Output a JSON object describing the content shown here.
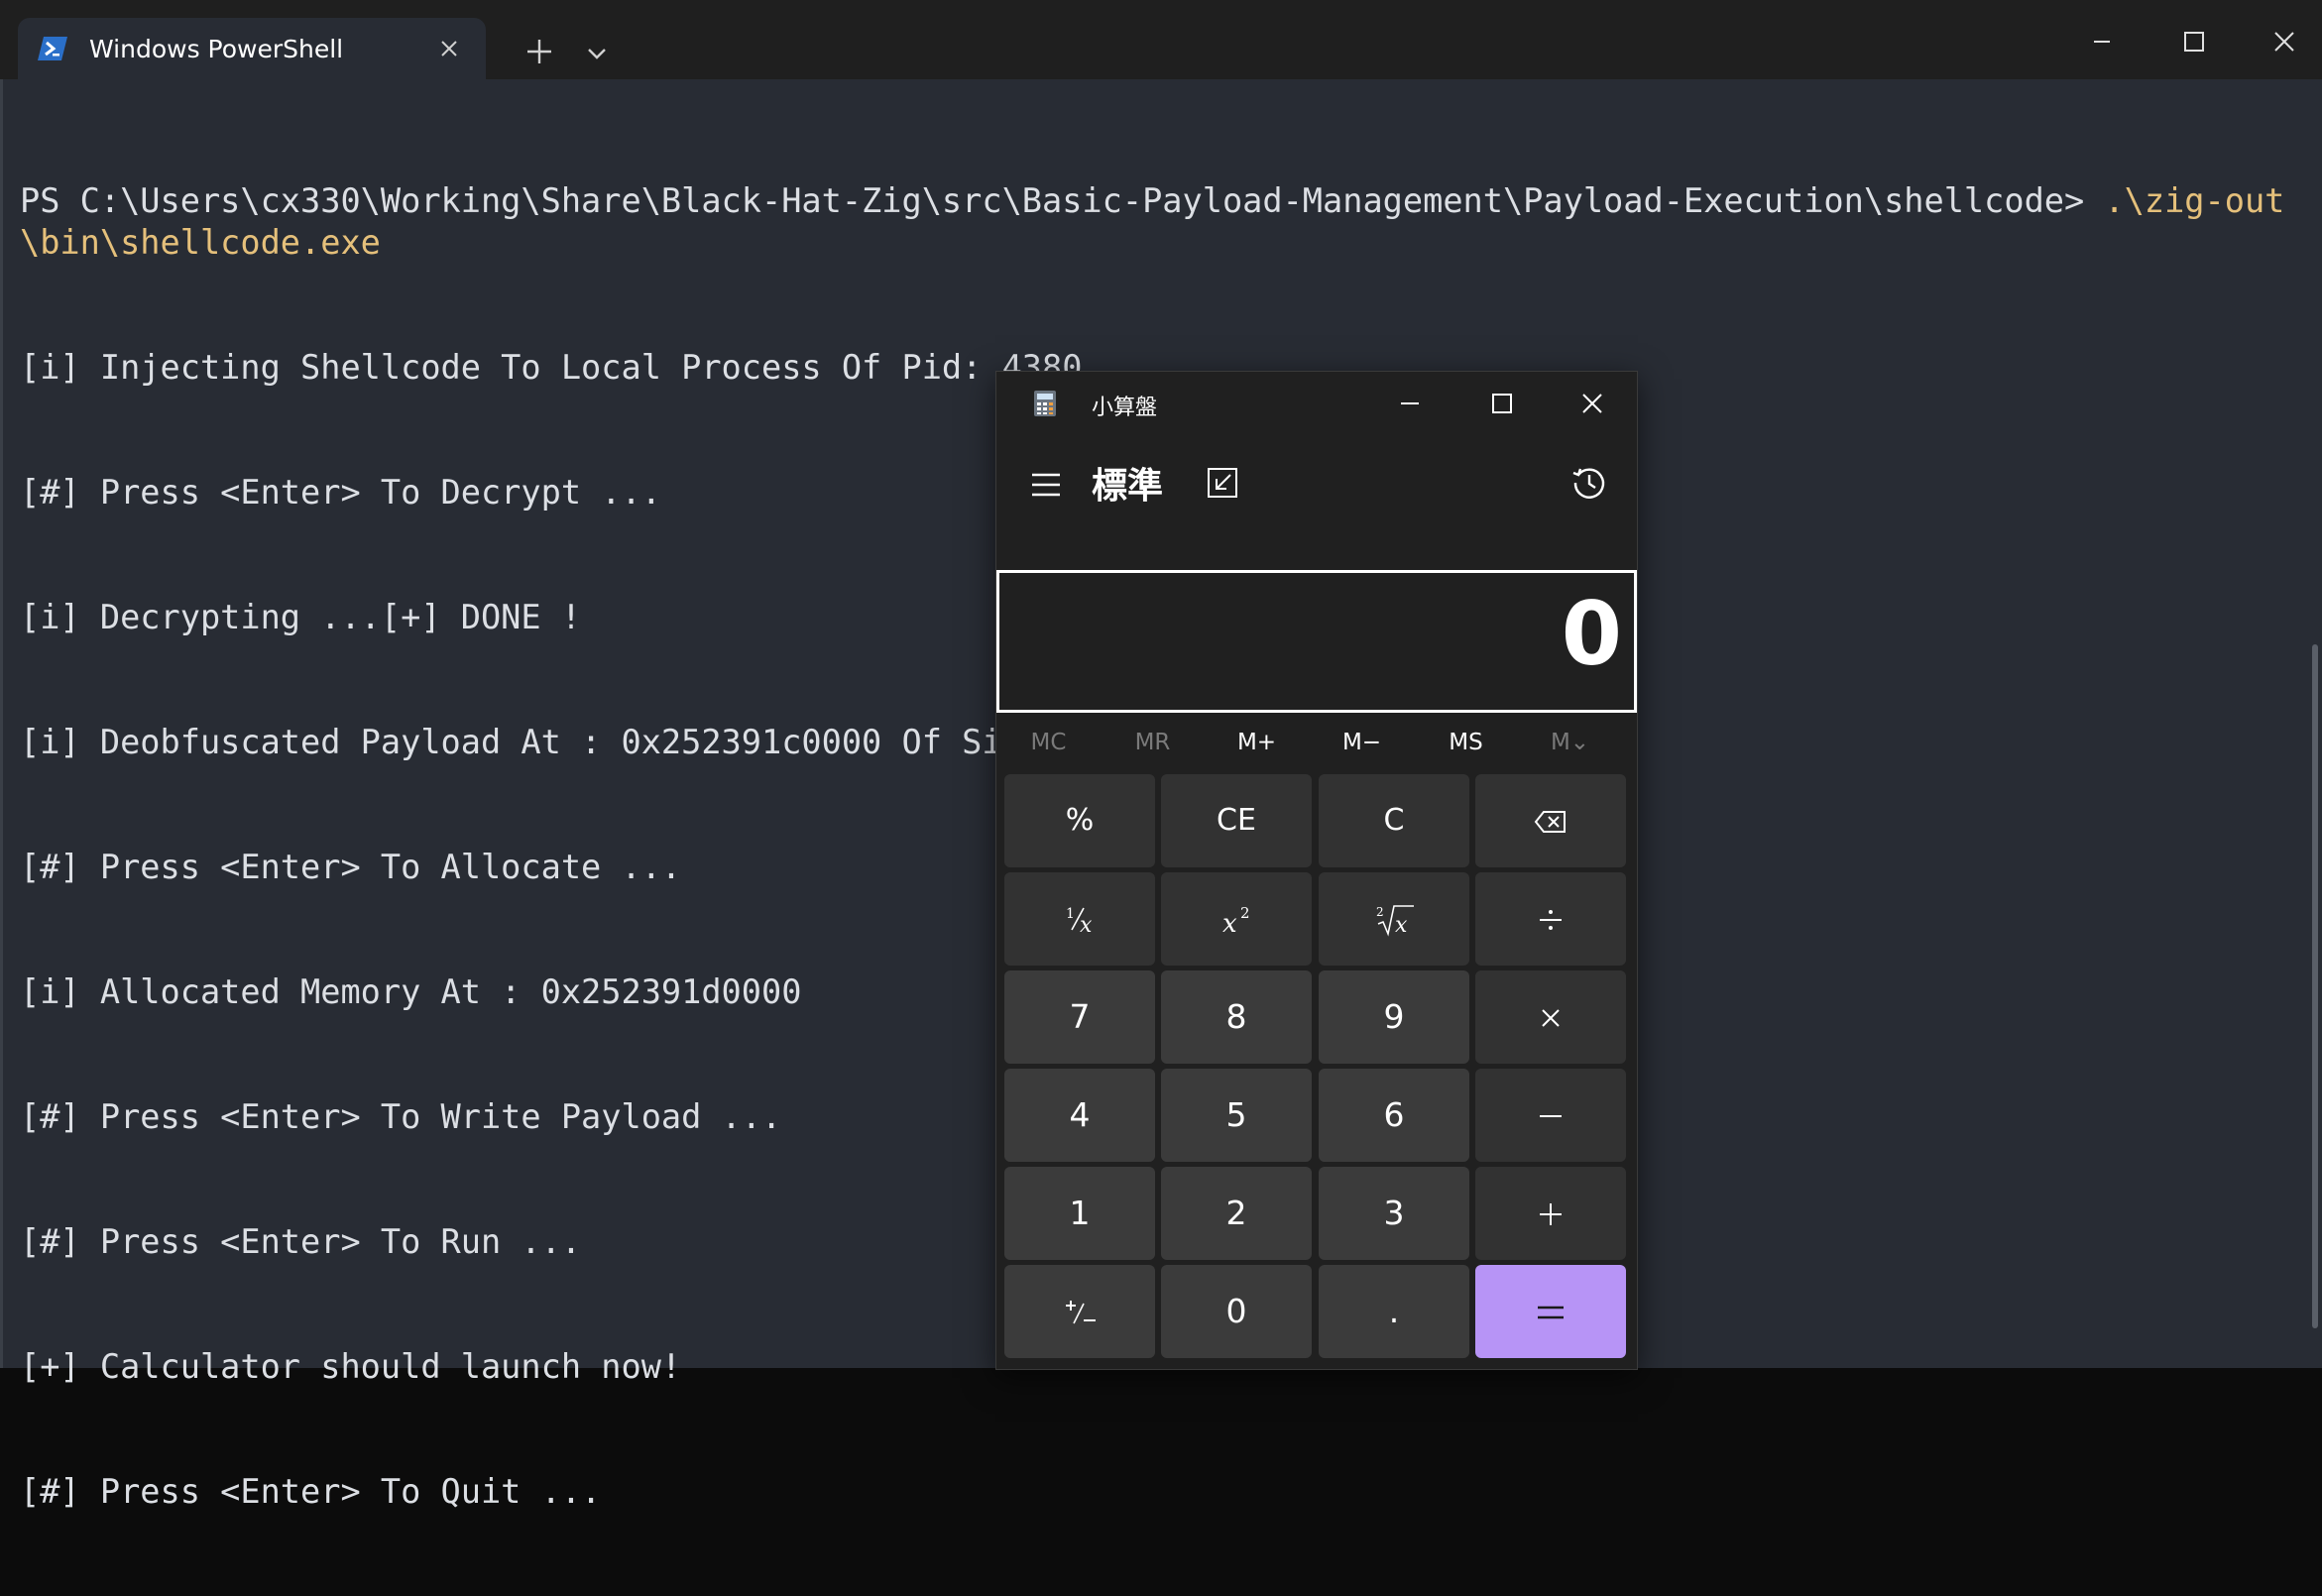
{
  "terminal": {
    "tab_title": "Windows PowerShell",
    "prompt": "PS C:\\Users\\cx330\\Working\\Share\\Black-Hat-Zig\\src\\Basic-Payload-Management\\Payload-Execution\\shellcode> ",
    "command": ".\\zig-out\\bin\\shellcode.exe",
    "output": [
      "[i] Injecting Shellcode To Local Process Of Pid: 4380",
      "[#] Press <Enter> To Decrypt ...",
      "[i] Decrypting ...[+] DONE !",
      "[i] Deobfuscated Payload At : 0x252391c0000 Of Size : 272",
      "[#] Press <Enter> To Allocate ...",
      "[i] Allocated Memory At : 0x252391d0000",
      "[#] Press <Enter> To Write Payload ...",
      "[#] Press <Enter> To Run ...",
      "[+] Calculator should launch now!",
      "[#] Press <Enter> To Quit ..."
    ],
    "colors": {
      "background": "#282c34",
      "text": "#dcdfe4",
      "command": "#e5c07b",
      "titlebar": "#1f1f1f"
    }
  },
  "calculator": {
    "title": "小算盤",
    "mode": "標準",
    "display": "0",
    "memory": [
      "MC",
      "MR",
      "M+",
      "M−",
      "MS",
      "M⌄"
    ],
    "keys": {
      "percent": "%",
      "ce": "CE",
      "c": "C",
      "n7": "7",
      "n8": "8",
      "n9": "9",
      "n4": "4",
      "n5": "5",
      "n6": "6",
      "n1": "1",
      "n2": "2",
      "n3": "3",
      "n0": "0",
      "decimal": "."
    },
    "colors": {
      "background": "#202020",
      "key": "#3b3b3b",
      "equals": "#b794f6"
    }
  }
}
